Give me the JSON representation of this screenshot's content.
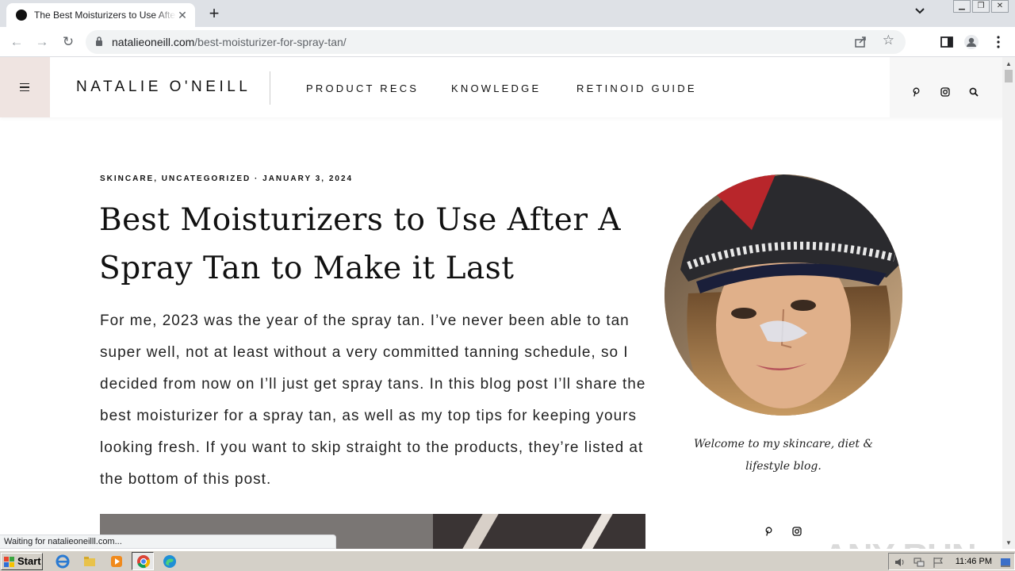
{
  "browser": {
    "tab_title": "The Best Moisturizers to Use After A",
    "url_domain": "natalieoneill.com",
    "url_path": "/best-moisturizer-for-spray-tan/",
    "status_text": "Waiting for natalieoneilll.com..."
  },
  "site": {
    "logo": "NATALIE O'NEILL",
    "nav": [
      "PRODUCT RECS",
      "KNOWLEDGE",
      "RETINOID GUIDE"
    ]
  },
  "article": {
    "meta": "SKINCARE, UNCATEGORIZED · JANUARY 3, 2024",
    "title": "Best Moisturizers to Use After A Spray Tan to Make it Last",
    "intro": "For me, 2023 was the year of the spray tan. I’ve never been able to tan super well, not at least without a very committed tanning schedule, so I decided from now on I’ll just get spray tans. In this blog post I’ll share the best moisturizer for a spray tan, as well as my top tips for keeping yours looking fresh. If you want to skip straight to the products, they’re listed at the bottom of this post."
  },
  "sidebar": {
    "welcome": "Welcome to my skincare, diet & lifestyle blog."
  },
  "watermark": "ANY RUN",
  "taskbar": {
    "start_label": "Start",
    "clock": "11:46 PM"
  },
  "icons": {
    "social": [
      "pinterest-icon",
      "instagram-icon",
      "search-icon"
    ],
    "accent_menu_bg": "#efe4e1"
  }
}
